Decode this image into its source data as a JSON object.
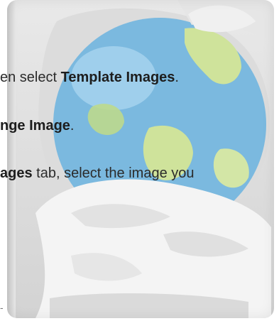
{
  "steps": [
    {
      "prefix": "en select ",
      "bold": "Template Images",
      "suffix": "."
    },
    {
      "prefix": "",
      "bold": "nge Image",
      "suffix": "."
    },
    {
      "prefix": "",
      "bold": "ages",
      "suffix": " tab, select the image you"
    }
  ],
  "trailing_mark": "-",
  "illustration": {
    "icon": "globe-icon",
    "colors": {
      "globe": "#79b7de",
      "land": "#cfe39a",
      "wrap": "#f5f5f5",
      "shadow": "#c4c4c4"
    }
  }
}
